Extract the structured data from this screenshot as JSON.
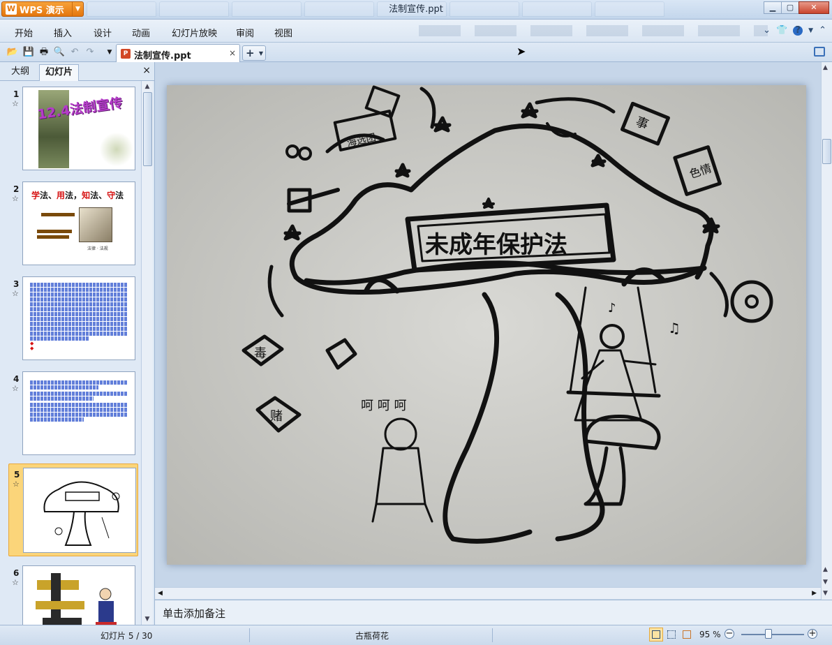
{
  "app": {
    "brand_label": "WPS 演示",
    "window_title": "法制宣传.ppt"
  },
  "menu": {
    "items": [
      "开始",
      "插入",
      "设计",
      "动画",
      "幻灯片放映",
      "审阅",
      "视图"
    ]
  },
  "document_tab": {
    "name": "法制宣传.ppt",
    "close_glyph": "×",
    "new_tab_glyph": "+"
  },
  "panel": {
    "tabs": [
      "大纲",
      "幻灯片"
    ],
    "active_tab": "幻灯片",
    "close_glyph": "×"
  },
  "thumbnails": [
    {
      "number": "1",
      "title": "12.4法制宣传"
    },
    {
      "number": "2",
      "title_parts": [
        "学",
        "法、",
        "用",
        "法，",
        "知",
        "法、",
        "守",
        "法"
      ],
      "caption": "法律 · 法规"
    },
    {
      "number": "3"
    },
    {
      "number": "4"
    },
    {
      "number": "5",
      "selected": true
    },
    {
      "number": "6"
    }
  ],
  "slide": {
    "banner_text": "未成年保护法",
    "sign_text": "海选团",
    "box_text_1": "事",
    "box_text_2": "色情",
    "cube_text_1": "毒",
    "cube_text_2": "赌",
    "speech_text": "呵 呵 呵",
    "music_glyph": "♪",
    "music_glyph_2": "♫"
  },
  "notes": {
    "placeholder": "单击添加备注"
  },
  "status": {
    "slide_counter": "幻灯片 5 / 30",
    "theme_name": "古瓶荷花",
    "zoom": "95 %",
    "zoom_minus": "−",
    "zoom_plus": "+"
  },
  "icons": {
    "open": "folder-open-icon",
    "save": "save-icon",
    "print": "print-icon",
    "preview": "print-preview-icon",
    "undo": "undo-icon",
    "redo": "redo-icon"
  }
}
